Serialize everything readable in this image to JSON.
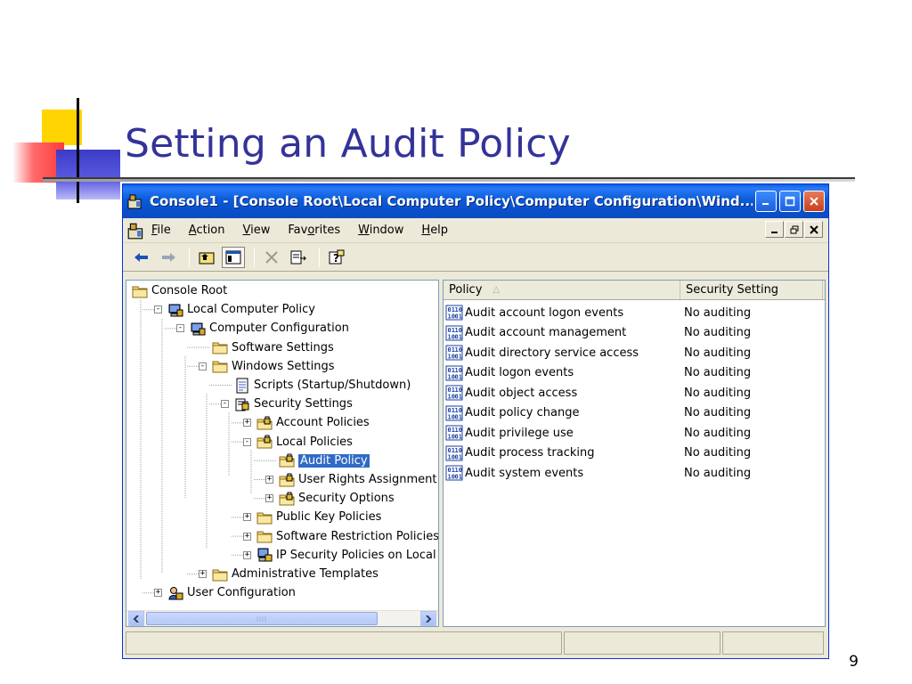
{
  "slide": {
    "title": "Setting an Audit Policy",
    "number": "9"
  },
  "window": {
    "title": "Console1 - [Console Root\\Local Computer Policy\\Computer Configuration\\Wind...",
    "menu": [
      {
        "label": "File",
        "u": "F",
        "rest": "ile"
      },
      {
        "label": "Action",
        "u": "A",
        "rest": "ction"
      },
      {
        "label": "View",
        "u": "V",
        "rest": "iew"
      },
      {
        "label": "Favorites",
        "pre": "Fav",
        "u": "o",
        "rest": "rites"
      },
      {
        "label": "Window",
        "u": "W",
        "rest": "indow"
      },
      {
        "label": "Help",
        "u": "H",
        "rest": "elp"
      }
    ]
  },
  "tree": [
    {
      "label": "Console Root",
      "expander": "",
      "icon": "folder-icon"
    },
    {
      "label": "Local Computer Policy",
      "expander": "-",
      "icon": "policy-computer-icon"
    },
    {
      "label": "Computer Configuration",
      "expander": "-",
      "icon": "computer-icon"
    },
    {
      "label": "Software Settings",
      "expander": "",
      "icon": "folder-icon"
    },
    {
      "label": "Windows Settings",
      "expander": "-",
      "icon": "folder-icon"
    },
    {
      "label": "Scripts (Startup/Shutdown)",
      "expander": "",
      "icon": "script-icon"
    },
    {
      "label": "Security Settings",
      "expander": "-",
      "icon": "security-settings-icon"
    },
    {
      "label": "Account Policies",
      "expander": "+",
      "icon": "locked-folder-icon"
    },
    {
      "label": "Local Policies",
      "expander": "-",
      "icon": "locked-folder-icon"
    },
    {
      "label": "Audit Policy",
      "expander": "",
      "icon": "locked-folder-icon",
      "selected": true
    },
    {
      "label": "User Rights Assignment",
      "expander": "+",
      "icon": "locked-folder-icon"
    },
    {
      "label": "Security Options",
      "expander": "+",
      "icon": "locked-folder-icon"
    },
    {
      "label": "Public Key Policies",
      "expander": "+",
      "icon": "folder-icon"
    },
    {
      "label": "Software Restriction Policies",
      "expander": "+",
      "icon": "folder-icon"
    },
    {
      "label": "IP Security Policies on Local Cc",
      "expander": "+",
      "icon": "ip-security-icon"
    },
    {
      "label": "Administrative Templates",
      "expander": "+",
      "icon": "folder-icon"
    },
    {
      "label": "User Configuration",
      "expander": "+",
      "icon": "user-config-icon"
    }
  ],
  "list": {
    "columns": [
      "Policy",
      "Security Setting"
    ],
    "rows": [
      {
        "policy": "Audit account logon events",
        "setting": "No auditing"
      },
      {
        "policy": "Audit account management",
        "setting": "No auditing"
      },
      {
        "policy": "Audit directory service access",
        "setting": "No auditing"
      },
      {
        "policy": "Audit logon events",
        "setting": "No auditing"
      },
      {
        "policy": "Audit object access",
        "setting": "No auditing"
      },
      {
        "policy": "Audit policy change",
        "setting": "No auditing"
      },
      {
        "policy": "Audit privilege use",
        "setting": "No auditing"
      },
      {
        "policy": "Audit process tracking",
        "setting": "No auditing"
      },
      {
        "policy": "Audit system events",
        "setting": "No auditing"
      }
    ]
  },
  "colors": {
    "title": "#333399",
    "selection": "#316ac5",
    "titlebar": "#0b5bd9"
  }
}
